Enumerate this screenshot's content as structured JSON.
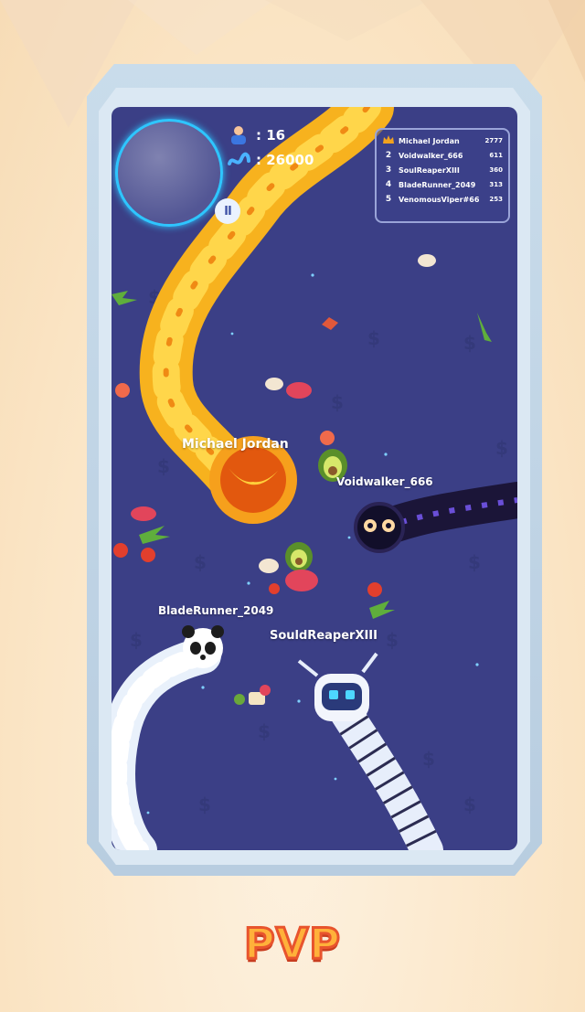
{
  "hud": {
    "player_count": ": 16",
    "score": ": 26000",
    "pause_label": "II",
    "player_icon": "players-icon",
    "score_icon": "worm-score-icon"
  },
  "leaderboard": [
    {
      "rank": "",
      "name": "Michael Jordan",
      "score": "2777"
    },
    {
      "rank": "2",
      "name": "Voidwalker_666",
      "score": "611"
    },
    {
      "rank": "3",
      "name": "SoulReaperXIII",
      "score": "360"
    },
    {
      "rank": "4",
      "name": "BladeRunner_2049",
      "score": "313"
    },
    {
      "rank": "5",
      "name": "VenomousViper#666",
      "score": "253"
    }
  ],
  "players": {
    "fire": "Michael Jordan",
    "void": "Voidwalker_666",
    "panda": "BladeRunner_2049",
    "robot": "SouldReaperXIII"
  },
  "title": "PVP",
  "colors": {
    "arena": "#3b3f86",
    "minimap_ring": "#2ec6ff",
    "title_fill": "#ffb13a",
    "title_stroke": "#e8542d"
  }
}
